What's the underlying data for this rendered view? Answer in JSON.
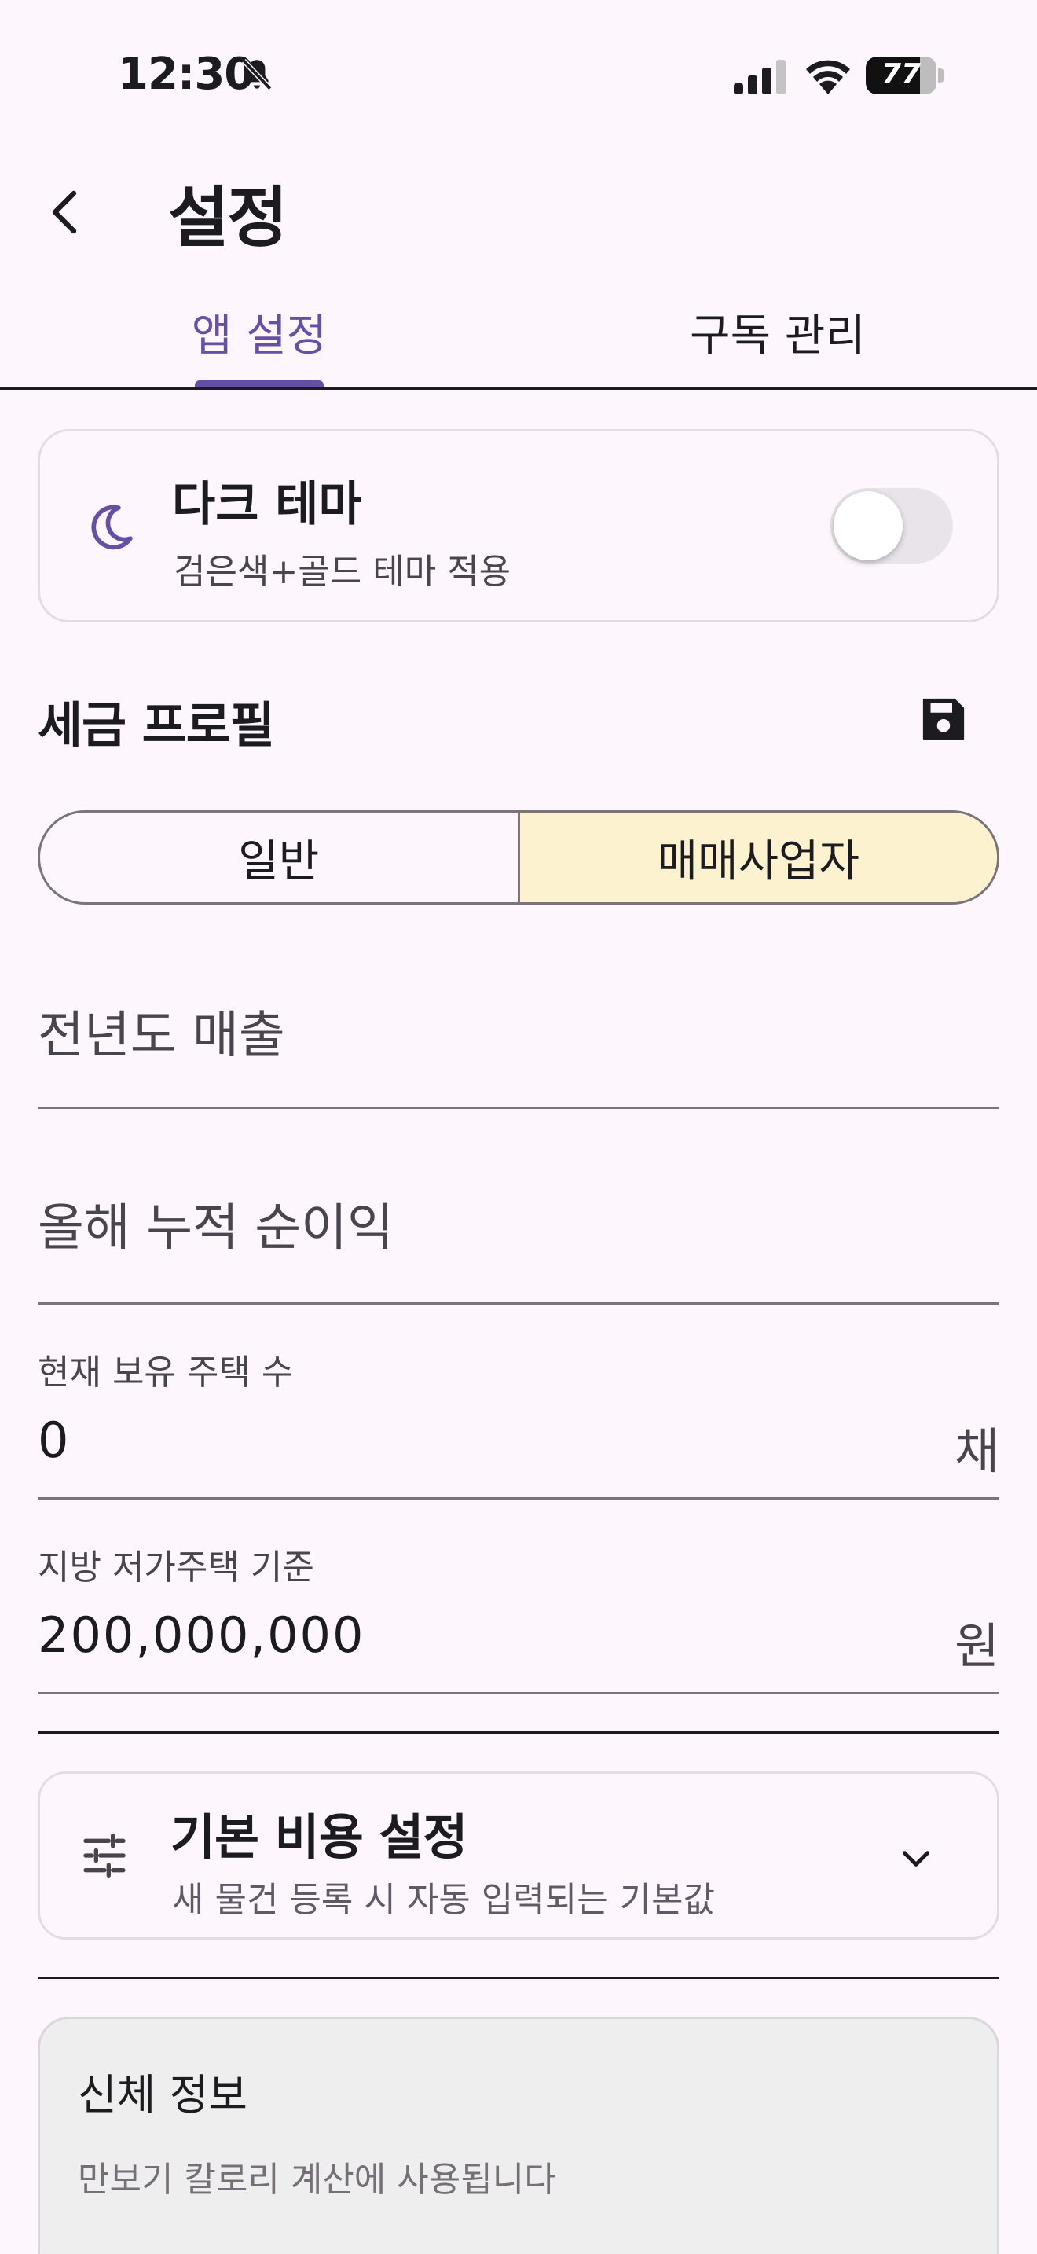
{
  "status_bar": {
    "time": "12:30",
    "battery": "77",
    "battery_level": 0.77
  },
  "header": {
    "title": "설정"
  },
  "tabs": [
    {
      "label": "앱 설정",
      "active": true
    },
    {
      "label": "구독 관리",
      "active": false
    }
  ],
  "dark_theme": {
    "title": "다크 테마",
    "subtitle": "검은색+골드 테마 적용",
    "enabled": false
  },
  "tax_profile": {
    "title": "세금 프로필",
    "segments": [
      {
        "label": "일반",
        "selected": false
      },
      {
        "label": "매매사업자",
        "selected": true
      }
    ],
    "fields": {
      "prev_year_sales": {
        "placeholder": "전년도 매출"
      },
      "ytd_net_profit": {
        "placeholder": "올해 누적 순이익"
      },
      "houses_owned": {
        "label": "현재 보유 주택 수",
        "value": "0",
        "suffix": "채"
      },
      "low_price_standard": {
        "label": "지방 저가주택 기준",
        "value": "200,000,000",
        "suffix": "원"
      }
    }
  },
  "default_cost": {
    "title": "기본 비용 설정",
    "subtitle": "새 물건 등록 시 자동 입력되는 기본값"
  },
  "body_info": {
    "title": "신체 정보",
    "subtitle": "만보기 칼로리 계산에 사용됩니다"
  },
  "colors": {
    "accent": "#6750a4",
    "background": "#fdf7fd",
    "segment_selected": "#fdf2cf"
  }
}
